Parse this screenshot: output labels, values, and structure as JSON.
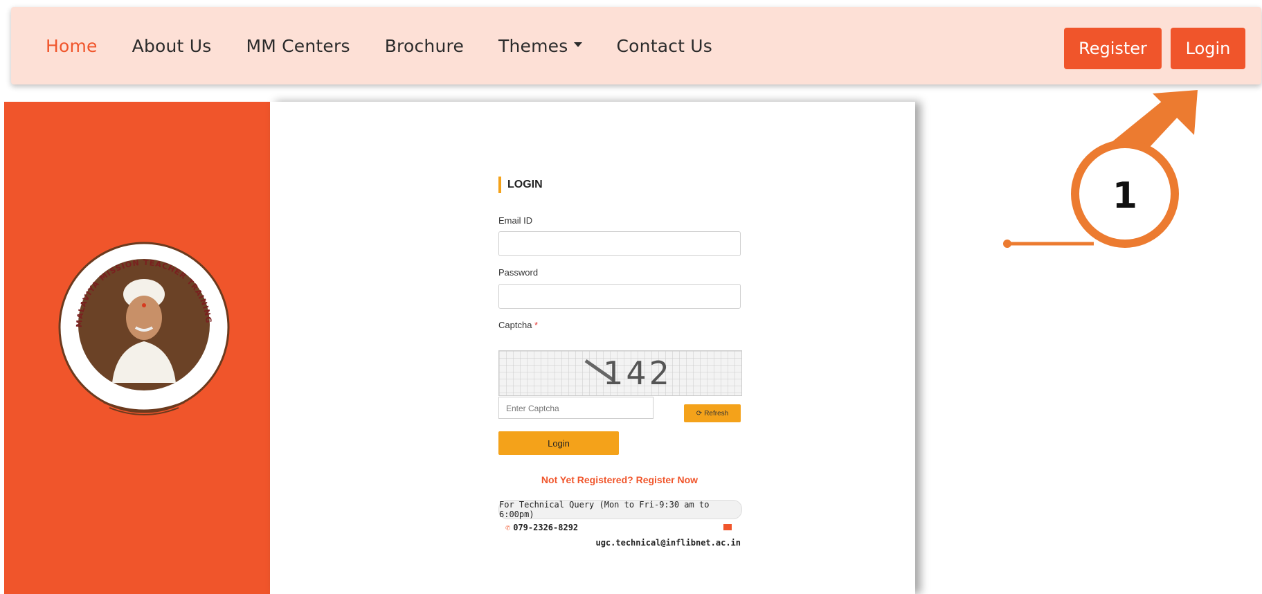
{
  "nav": {
    "items": [
      {
        "label": "Home",
        "active": true
      },
      {
        "label": "About Us"
      },
      {
        "label": "MM Centers"
      },
      {
        "label": "Brochure"
      },
      {
        "label": "Themes"
      },
      {
        "label": "Contact Us"
      }
    ],
    "register_label": "Register",
    "login_label": "Login"
  },
  "annotation": {
    "number": "1"
  },
  "logo": {
    "ring_text": "MALAVIYA MISSION TEACHER TRAINING PROGRAMME"
  },
  "login": {
    "title": "LOGIN",
    "email_label": "Email ID",
    "password_label": "Password",
    "captcha_label": "Captcha",
    "captcha_required": "*",
    "captcha_code": "142",
    "captcha_placeholder": "Enter Captcha",
    "refresh_label": "Refresh",
    "login_button": "Login",
    "register_text": "Not Yet Registered? Register Now",
    "tech_query": "For Technical Query (Mon to Fri-9:30 am to 6:00pm)",
    "phone": "079-2326-8292",
    "email": "ugc.technical@inflibnet.ac.in"
  },
  "colors": {
    "accent": "#f0552b",
    "nav_bg": "#fde0d6",
    "button_yellow": "#f4a21a",
    "annotation": "#ec7b30"
  }
}
